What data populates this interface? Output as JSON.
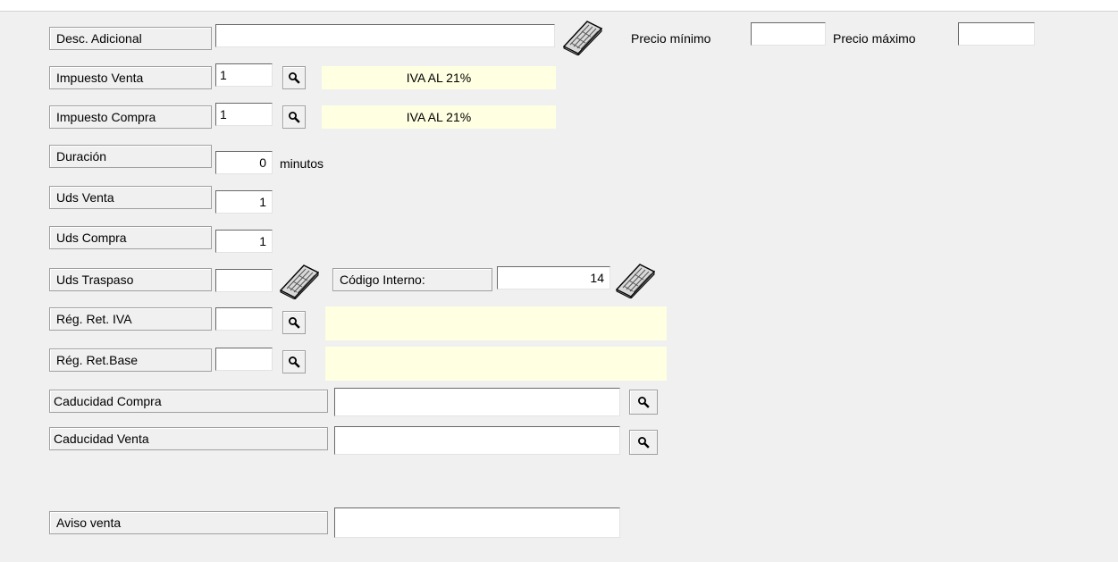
{
  "desc_adicional": {
    "label": "Desc. Adicional",
    "value": ""
  },
  "precio_minimo": {
    "label": "Precio mínimo",
    "value": ""
  },
  "precio_maximo": {
    "label": "Precio máximo",
    "value": ""
  },
  "impuesto_venta": {
    "label": "Impuesto Venta",
    "code": "1",
    "description": "IVA AL 21%"
  },
  "impuesto_compra": {
    "label": "Impuesto Compra",
    "code": "1",
    "description": "IVA AL 21%"
  },
  "duracion": {
    "label": "Duración",
    "value": "0",
    "unit": "minutos"
  },
  "uds_venta": {
    "label": "Uds Venta",
    "value": "1"
  },
  "uds_compra": {
    "label": "Uds Compra",
    "value": "1"
  },
  "uds_traspaso": {
    "label": "Uds Traspaso",
    "value": ""
  },
  "codigo_interno": {
    "label": "Código Interno:",
    "value": "14"
  },
  "reg_ret_iva": {
    "label": "Rég. Ret. IVA",
    "code": "",
    "description": ""
  },
  "reg_ret_base": {
    "label": "Rég. Ret.Base",
    "code": "",
    "description": ""
  },
  "caducidad_compra": {
    "label": "Caducidad Compra",
    "value": ""
  },
  "caducidad_venta": {
    "label": "Caducidad Venta",
    "value": ""
  },
  "aviso_venta": {
    "label": "Aviso venta",
    "value": ""
  },
  "icons": {
    "lookup": "magnifier-icon",
    "keyboard": "keyboard-icon"
  }
}
